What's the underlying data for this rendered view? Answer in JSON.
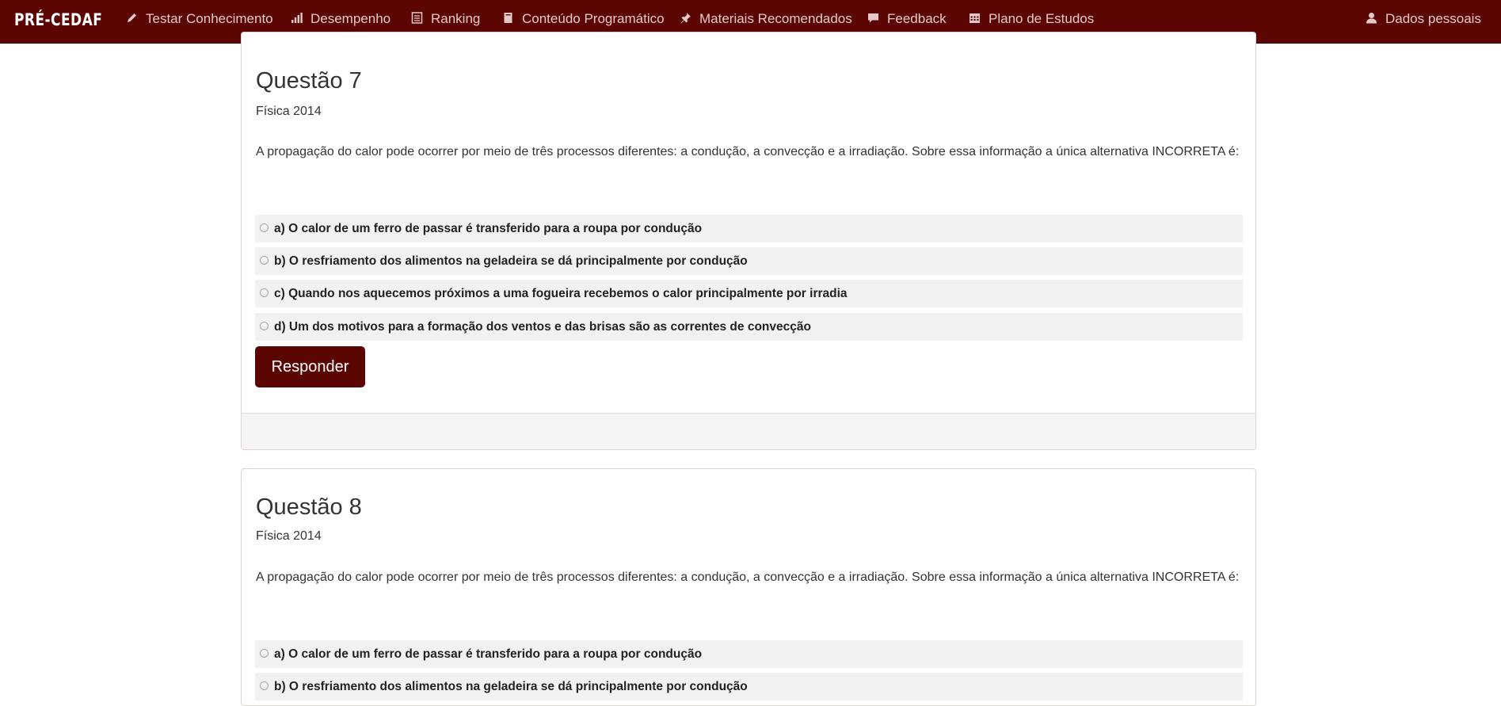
{
  "nav": {
    "brand": "PRÉ-CEDAF",
    "items": [
      {
        "label": "Testar Conhecimento",
        "icon": "pencil-icon"
      },
      {
        "label": "Desempenho",
        "icon": "signal-bars-icon"
      },
      {
        "label": "Ranking",
        "icon": "list-document-icon"
      },
      {
        "label": "Conteúdo Programático",
        "icon": "book-icon"
      },
      {
        "label": "Materiais Recomendados",
        "icon": "pushpin-icon"
      },
      {
        "label": "Feedback",
        "icon": "comment-icon"
      },
      {
        "label": "Plano de Estudos",
        "icon": "calendar-icon"
      }
    ],
    "user": {
      "label": "Dados pessoais",
      "icon": "user-icon"
    }
  },
  "questions": [
    {
      "title": "Questão 7",
      "subject": "Física 2014",
      "text": "A propagação do calor pode ocorrer por meio de três processos diferentes: a condução, a convecção e a irradiação. Sobre essa informação a única alternativa INCORRETA é:",
      "options": [
        "a) O calor de um ferro de passar é transferido para a roupa por condução",
        "b) O resfriamento dos alimentos na geladeira se dá principalmente por condução",
        "c) Quando nos aquecemos próximos a uma fogueira recebemos o calor principalmente por irradia",
        "d) Um dos motivos para a formação dos ventos e das brisas são as correntes de convecção"
      ],
      "button": "Responder"
    },
    {
      "title": "Questão 8",
      "subject": "Física 2014",
      "text": "A propagação do calor pode ocorrer por meio de três processos diferentes: a condução, a convecção e a irradiação. Sobre essa informação a única alternativa INCORRETA é:",
      "options": [
        "a) O calor de um ferro de passar é transferido para a roupa por condução",
        "b) O resfriamento dos alimentos na geladeira se dá principalmente por condução"
      ]
    }
  ],
  "colors": {
    "navbar": "#5c0604",
    "nav_text": "#e3c9c7",
    "button": "#5c0604",
    "option_bg": "#f1f1f1"
  }
}
